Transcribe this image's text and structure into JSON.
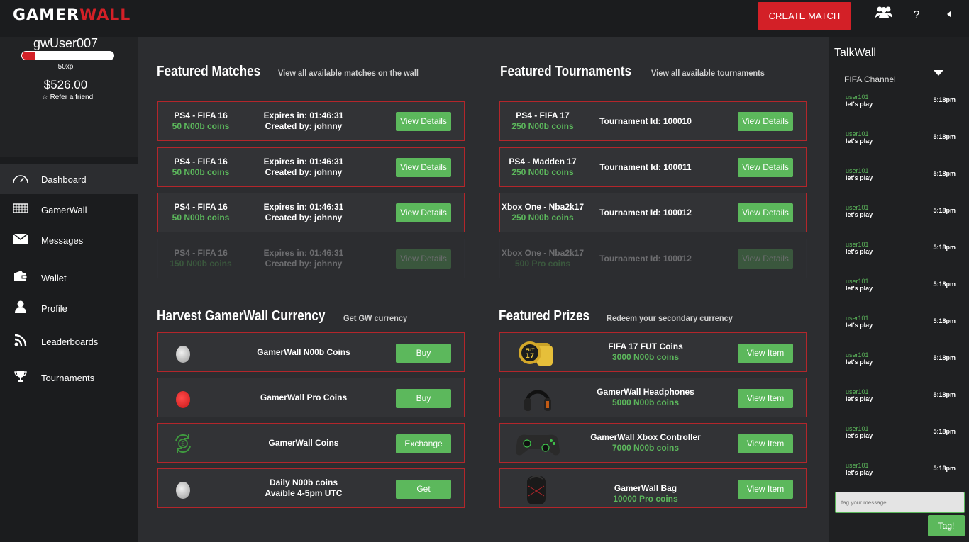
{
  "app": {
    "logo_white": "GAMER",
    "logo_red": "WALL"
  },
  "header": {
    "create_match": "CREATE MATCH",
    "help": "?",
    "icons": [
      "friends-icon",
      "help-icon",
      "collapse-icon"
    ]
  },
  "user": {
    "name": "gwUser007",
    "xp": "50xp",
    "xp_progress": 0.14,
    "balance": "$526.00",
    "refer": "Refer a friend"
  },
  "nav": [
    {
      "label": "Dashboard",
      "icon": "speedometer-icon",
      "active": true
    },
    {
      "label": "GamerWall",
      "icon": "grid-icon"
    },
    {
      "label": "Messages",
      "icon": "envelope-icon"
    },
    {
      "label": "Wallet",
      "icon": "wallet-icon"
    },
    {
      "label": "Profile",
      "icon": "user-icon"
    },
    {
      "label": "Leaderboards",
      "icon": "rss-icon"
    },
    {
      "label": "Tournaments",
      "icon": "trophy-icon"
    }
  ],
  "featured_matches": {
    "title": "Featured Matches",
    "subtitle": "View all available matches on the wall",
    "items": [
      {
        "game": "PS4 - FIFA 16",
        "stake": "50 N00b coins",
        "expires": "Expires in: 01:46:31",
        "creator": "Created by: johnny",
        "button": "View Details"
      },
      {
        "game": "PS4 - FIFA 16",
        "stake": "50 N00b coins",
        "expires": "Expires in: 01:46:31",
        "creator": "Created by: johnny",
        "button": "View Details"
      },
      {
        "game": "PS4 - FIFA 16",
        "stake": "50 N00b coins",
        "expires": "Expires in: 01:46:31",
        "creator": "Created by: johnny",
        "button": "View Details"
      },
      {
        "game": "PS4 - FIFA 16",
        "stake": "150 N00b coins",
        "expires": "Expires in: 01:46:31",
        "creator": "Created by: johnny",
        "button": "View Details"
      }
    ]
  },
  "featured_tournaments": {
    "title": "Featured Tournaments",
    "subtitle": "View all available tournaments",
    "items": [
      {
        "game": "PS4 - FIFA 17",
        "stake": "250 N00b coins",
        "tid": "Tournament Id: 100010",
        "button": "View Details"
      },
      {
        "game": "PS4 - Madden 17",
        "stake": "250 N00b coins",
        "tid": "Tournament Id: 100011",
        "button": "View Details"
      },
      {
        "game": "Xbox One - Nba2k17",
        "stake": "250 N00b coins",
        "tid": "Tournament Id: 100012",
        "button": "View Details"
      },
      {
        "game": "Xbox One - Nba2k17",
        "stake": "500 Pro coins",
        "tid": "Tournament Id: 100012",
        "button": "View Details"
      }
    ]
  },
  "harvest": {
    "title": "Harvest GamerWall Currency",
    "subtitle": "Get GW currency",
    "items": [
      {
        "label": "GamerWall N00b Coins",
        "button": "Buy",
        "icon": "silver-coin-icon"
      },
      {
        "label": "GamerWall Pro Coins",
        "button": "Buy",
        "icon": "red-coin-icon"
      },
      {
        "label": "GamerWall Coins",
        "button": "Exchange",
        "icon": "exchange-icon"
      },
      {
        "label": "Daily N00b coins",
        "label2": "Avaible 4-5pm UTC",
        "button": "Get",
        "icon": "silver-coin-icon"
      }
    ]
  },
  "prizes": {
    "title": "Featured Prizes",
    "subtitle": "Redeem your secondary currency",
    "items": [
      {
        "name": "FIFA 17 FUT Coins",
        "cost": "3000 N00b coins",
        "button": "View Item",
        "icon": "fut-coins-icon"
      },
      {
        "name": "GamerWall Headphones",
        "cost": "5000 N00b coins",
        "button": "View Item",
        "icon": "headphones-icon"
      },
      {
        "name": "GamerWall Xbox Controller",
        "cost": "7000 N00b coins",
        "button": "View Item",
        "icon": "controller-icon"
      },
      {
        "name": "GamerWall Bag",
        "cost": "10000 Pro coins",
        "button": "View Item",
        "icon": "bag-icon"
      }
    ]
  },
  "chat": {
    "title": "TalkWall",
    "channel": "FIFA Channel",
    "messages": [
      {
        "user": "user101",
        "text": "let's play",
        "time": "5:18pm"
      },
      {
        "user": "user101",
        "text": "let's play",
        "time": "5:18pm"
      },
      {
        "user": "user101",
        "text": "let's play",
        "time": "5:18pm"
      },
      {
        "user": "user101",
        "text": "let's play",
        "time": "5:18pm"
      },
      {
        "user": "user101",
        "text": "let's play",
        "time": "5:18pm"
      },
      {
        "user": "user101",
        "text": "let's play",
        "time": "5:18pm"
      },
      {
        "user": "user101",
        "text": "let's play",
        "time": "5:18pm"
      },
      {
        "user": "user101",
        "text": "let's play",
        "time": "5:18pm"
      },
      {
        "user": "user101",
        "text": "let's play",
        "time": "5:18pm"
      },
      {
        "user": "user101",
        "text": "let's play",
        "time": "5:18pm"
      },
      {
        "user": "user101",
        "text": "let's play",
        "time": "5:18pm"
      }
    ],
    "placeholder": "tag your message...",
    "send": "Tag!"
  }
}
